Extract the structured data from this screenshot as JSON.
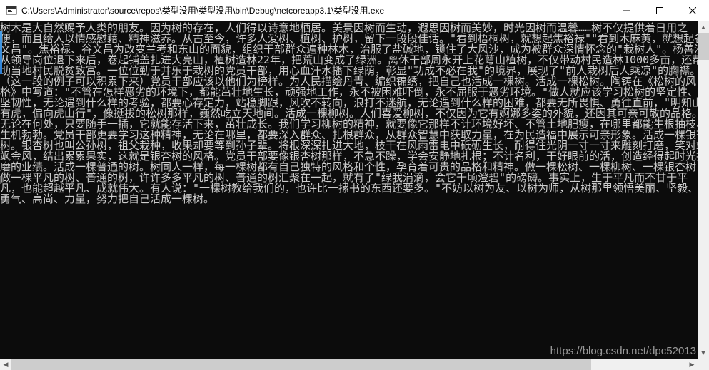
{
  "window": {
    "title": "C:\\Users\\Administrator\\source\\repos\\类型没用\\类型没用\\bin\\Debug\\netcoreapp3.1\\类型没用.exe"
  },
  "console": {
    "text": "树木是大自然赐予人类的朋友。因为树的存在，人们得以诗意地栖居。美景因树而生动，遐思因树而美妙，时光因树而温馨……树不仅提供着日用之便，而且给人以情感慰藉、精神滋养。从古至今，许多人爱树、植树、护树，留下一段段佳话。\"看到梧桐树，就想起焦裕禄\"\"看到木麻黄，就想起谷文昌\"。焦裕禄、谷文昌为改变兰考和东山的面貌，组织干部群众遍种林木，治服了盐碱地，锁住了大风沙，成为被群众深情怀念的\"栽树人\"。杨善洲从领导岗位退下来后，卷起铺盖扎进大亮山，植树造林22年，把荒山变成了绿洲。离休干部周永开上花萼山植树，不仅带动村民造林1000多亩，还帮助当地村民脱贫致富。一位位勤于并乐于栽树的党员干部，用心血汗水播下绿荫，彰显\"功成不必在我\"的境界，展现了\"前人栽树后人乘凉\"的胸襟。（这一段的例子可以积累下来）党员干部应该以他们为榜样。为人民描绘丹青、编织锦绣，把自己也活成一棵树。活成一棵松树。陶铸在《松树的风格》中写道：\"不管在怎样恶劣的环境下，都能茁壮地生长，顽强地工作，永不被困难吓倒，永不屈服于恶劣环境。\"做人就应该学习松树的坚定性、坚韧性，无论遇到什么样的考验，都要心存定力，站稳脚跟，风吹不转向，浪打不迷航，无论遇到什么样的困难，都要无所畏惧、勇往直前，\"明知山有虎，偏向虎山行\"，像挺拔的松树那样，巍然屹立天地间。活成一棵柳树。人们喜爱柳树，不仅因为它有婀娜多姿的外貌，还因其可亲可敬的品格。无论在何处，只要随手一插，它就能存活下来，茁壮成长。我们学习柳树的精神，就要像它那样不计环境好坏、不管土地肥瘦，在哪里都能生根抽枝、生机勃勃。党员干部更要学习这种精神，无论在哪里，都要深入群众、扎根群众，从群众智慧中获取力量，在为民造福中展示可亲形象。活成一棵银杏树。银杏树也叫公孙树，祖父栽种，收果却要等到孙子辈。将根深深扎进大地，枝干在风雨雷电中砥砺生长，耐得住光阴一寸一寸来雕刻打磨，笑对飒飒金风，结出累累果实，这就是银杏树的风格。党员干部要像银杏树那样，不急不躁，学会安静地扎根；不计名利，干好眼前的活，创造经得起时光打磨的业绩。活成一棵普通的树。树同人一样，每一棵树都有自己独特的风格和个性，孕育着可贵的品格和精神。做一棵松树、一棵柳树、一棵银杏树，做一棵平凡的树、普通的树，许许多多平凡的树、普通的树汇聚在一起，就有了\"绿我涓滴，会它千顷澄碧\"的磅礴。事实上，生于平凡而不甘于平凡，也能超越平凡、成就伟大。有人说：\"一棵树教给我们的，也许比一摞书的东西还要多。\"不妨以树为友、以树为师，从树那里领悟美丽、坚毅、勇气、高尚、力量，努力把自己活成一棵树。"
  },
  "watermark": {
    "text": "https://blog.csdn.net/dpc52013"
  }
}
